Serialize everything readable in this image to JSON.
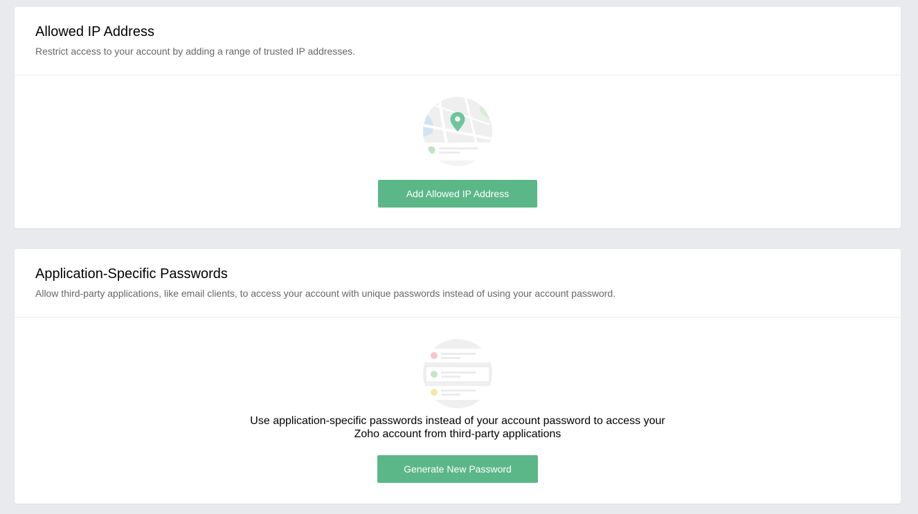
{
  "allowed_ip": {
    "title": "Allowed IP Address",
    "description": "Restrict access to your account by adding a range of trusted IP addresses.",
    "illustration_icon": "map-pin-icon",
    "button_label": "Add Allowed IP Address"
  },
  "app_passwords": {
    "title": "Application-Specific Passwords",
    "description": "Allow third-party applications, like email clients, to access your account with unique passwords instead of using your account password.",
    "illustration_icon": "password-list-icon",
    "info_text": "Use application-specific passwords instead of your account password to access your Zoho account from third-party applications",
    "button_label": "Generate New Password"
  },
  "colors": {
    "accent": "#5bb787",
    "background": "#e9eaee",
    "card": "#ffffff",
    "description_text": "#666666"
  }
}
